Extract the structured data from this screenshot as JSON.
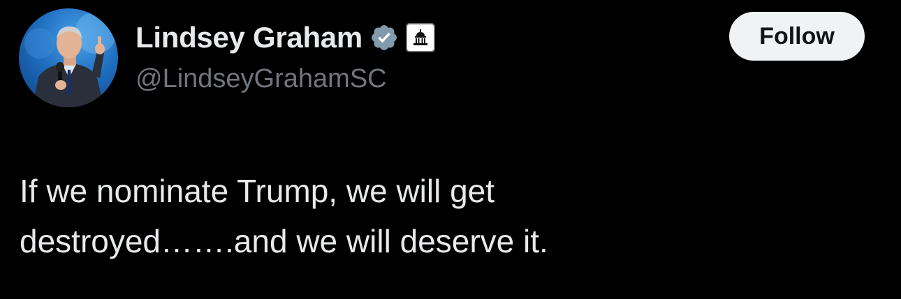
{
  "author": {
    "display_name": "Lindsey Graham",
    "handle": "@LindseyGrahamSC",
    "verified": true,
    "verified_color": "#829aab",
    "affiliate_badge_icon": "capitol-building-icon",
    "avatar_alt": "Profile photo"
  },
  "follow_button": {
    "label": "Follow"
  },
  "tweet": {
    "lines": [
      "If we nominate Trump, we will get",
      "destroyed…….and we will deserve it."
    ]
  },
  "colors": {
    "background": "#000000",
    "text_primary": "#e7e9ea",
    "text_secondary": "#71767b",
    "button_bg": "#eff3f4",
    "button_text": "#0f1419"
  }
}
